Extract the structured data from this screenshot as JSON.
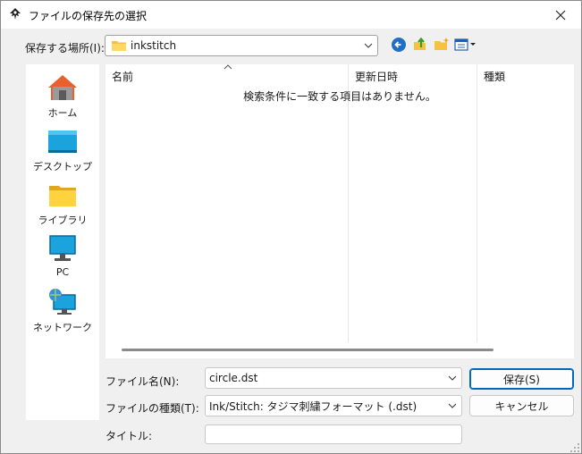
{
  "window": {
    "title": "ファイルの保存先の選択"
  },
  "location": {
    "label": "保存する場所(I):",
    "value": "inkstitch"
  },
  "toolbar": {
    "back_icon": "back-arrow-icon",
    "up_icon": "up-folder-icon",
    "new_folder_icon": "new-folder-icon",
    "view_icon": "view-menu-icon"
  },
  "places": [
    {
      "label": "ホーム",
      "icon": "home-icon"
    },
    {
      "label": "デスクトップ",
      "icon": "desktop-icon"
    },
    {
      "label": "ライブラリ",
      "icon": "library-icon"
    },
    {
      "label": "PC",
      "icon": "pc-icon"
    },
    {
      "label": "ネットワーク",
      "icon": "network-icon"
    }
  ],
  "filelist": {
    "columns": [
      "名前",
      "更新日時",
      "種類"
    ],
    "empty_message": "検索条件に一致する項目はありません。"
  },
  "form": {
    "filename_label": "ファイル名(N):",
    "filename_value": "circle.dst",
    "filetype_label": "ファイルの種類(T):",
    "filetype_value": "Ink/Stitch: タジマ刺繍フォーマット (.dst)",
    "title_label": "タイトル:",
    "title_value": ""
  },
  "buttons": {
    "save": "保存(S)",
    "cancel": "キャンセル"
  },
  "colors": {
    "accent": "#0067c0",
    "folder": "#f5c242",
    "home_roof": "#e8612c"
  }
}
